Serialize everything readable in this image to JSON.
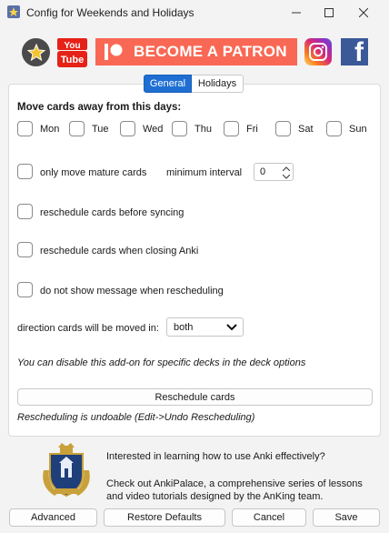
{
  "window": {
    "title": "Config for Weekends and Holidays",
    "controls": {
      "minimize": "—",
      "maximize": "☐",
      "close": "✕"
    }
  },
  "banner": {
    "icons": [
      "anki-guy-icon",
      "youtube-icon",
      "patreon-icon",
      "instagram-icon",
      "facebook-icon"
    ],
    "youtube_top": "You",
    "youtube_bottom": "Tube",
    "patron_label": "BECOME A PATRON",
    "facebook_letter": "f",
    "colors": {
      "patreon": "#f96854",
      "youtube": "#e62117",
      "facebook": "#3b5998"
    }
  },
  "tabs": [
    {
      "label": "General",
      "active": true
    },
    {
      "label": "Holidays",
      "active": false
    }
  ],
  "general": {
    "heading": "Move cards away from this days:",
    "days": [
      "Mon",
      "Tue",
      "Wed",
      "Thu",
      "Fri",
      "Sat",
      "Sun"
    ],
    "mature_label": "only move mature cards",
    "min_interval_label": "minimum interval",
    "min_interval_value": "0",
    "reschedule_sync_label": "reschedule cards before syncing",
    "reschedule_close_label": "reschedule cards when closing Anki",
    "no_message_label": "do not show message when rescheduling",
    "direction_label": "direction cards will be moved in:",
    "direction_value": "both",
    "disable_hint": "You can disable this add-on for specific decks in the deck options",
    "reschedule_button": "Reschedule cards",
    "undo_hint": "Rescheduling is undoable (Edit->Undo Rescheduling)"
  },
  "promo": {
    "line1": "Interested in learning how to use Anki effectively?",
    "line2": "Check out AnkiPalace, a comprehensive series of lessons",
    "line3": "and video tutorials designed by the AnKing team."
  },
  "buttons": {
    "advanced": "Advanced",
    "restore": "Restore Defaults",
    "cancel": "Cancel",
    "save": "Save"
  },
  "accent": "#1f6fd2"
}
